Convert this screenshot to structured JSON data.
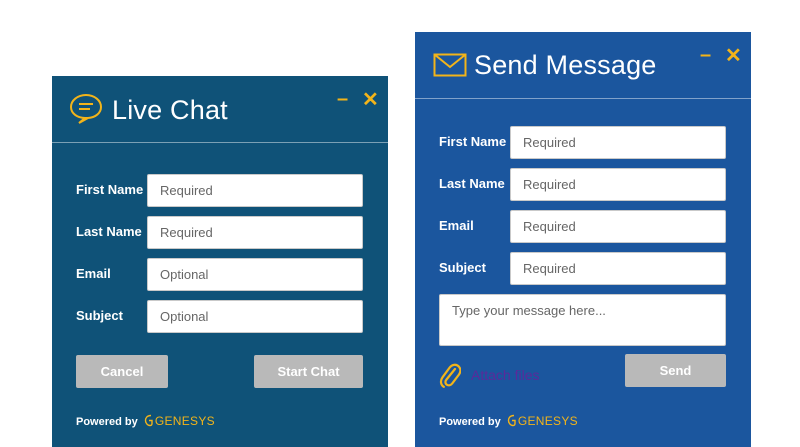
{
  "colors": {
    "chat_bg": "#0f5278",
    "message_bg": "#1b569e",
    "accent": "#f2b41a",
    "button_bg": "#b9b9b9",
    "attach_text": "#5b2a9a"
  },
  "chat": {
    "title": "Live Chat",
    "icon": "chat-bubble-icon",
    "minimize": "–",
    "close": "✕",
    "fields": [
      {
        "label": "First Name",
        "placeholder": "Required"
      },
      {
        "label": "Last Name",
        "placeholder": "Required"
      },
      {
        "label": "Email",
        "placeholder": "Optional"
      },
      {
        "label": "Subject",
        "placeholder": "Optional"
      }
    ],
    "cancel_label": "Cancel",
    "start_label": "Start Chat",
    "powered_by": "Powered by",
    "brand": "GENESYS"
  },
  "message": {
    "title": "Send Message",
    "icon": "envelope-icon",
    "minimize": "–",
    "close": "✕",
    "fields": [
      {
        "label": "First Name",
        "placeholder": "Required"
      },
      {
        "label": "Last Name",
        "placeholder": "Required"
      },
      {
        "label": "Email",
        "placeholder": "Required"
      },
      {
        "label": "Subject",
        "placeholder": "Required"
      }
    ],
    "message_placeholder": "Type your message here...",
    "attach_label": "Attach files",
    "send_label": "Send",
    "powered_by": "Powered by",
    "brand": "GENESYS"
  }
}
